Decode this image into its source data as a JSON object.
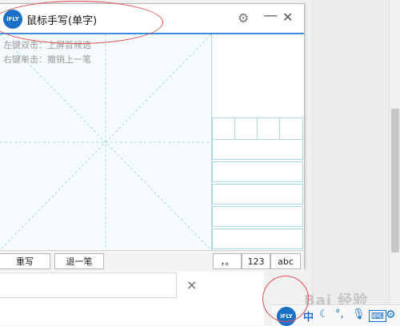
{
  "window": {
    "logo_text": "iFLY",
    "title": "鼠标手写(单字)",
    "hint_double_click": "左键双击：上屏首候选",
    "hint_right_click": "右键单击：撤销上一笔",
    "rewrite_label": "重写",
    "undo_label": "退一笔",
    "punct_label": "，。",
    "digits_label": "123",
    "letters_label": "abc"
  },
  "background": {
    "close_symbol": "×"
  },
  "tray": {
    "logo_text": "iFLY",
    "zh_label": "中",
    "watermark": "Bai 经验"
  },
  "colors": {
    "accent": "#3b8edb",
    "grid_line": "#a9d8e6",
    "annotation": "#e05050",
    "ifly_blue": "#1a6fc7"
  },
  "icons": [
    "gear-icon",
    "minimize-icon",
    "close-icon",
    "moon-icon",
    "punctuation-icon",
    "microphone-icon",
    "keyboard-icon"
  ]
}
